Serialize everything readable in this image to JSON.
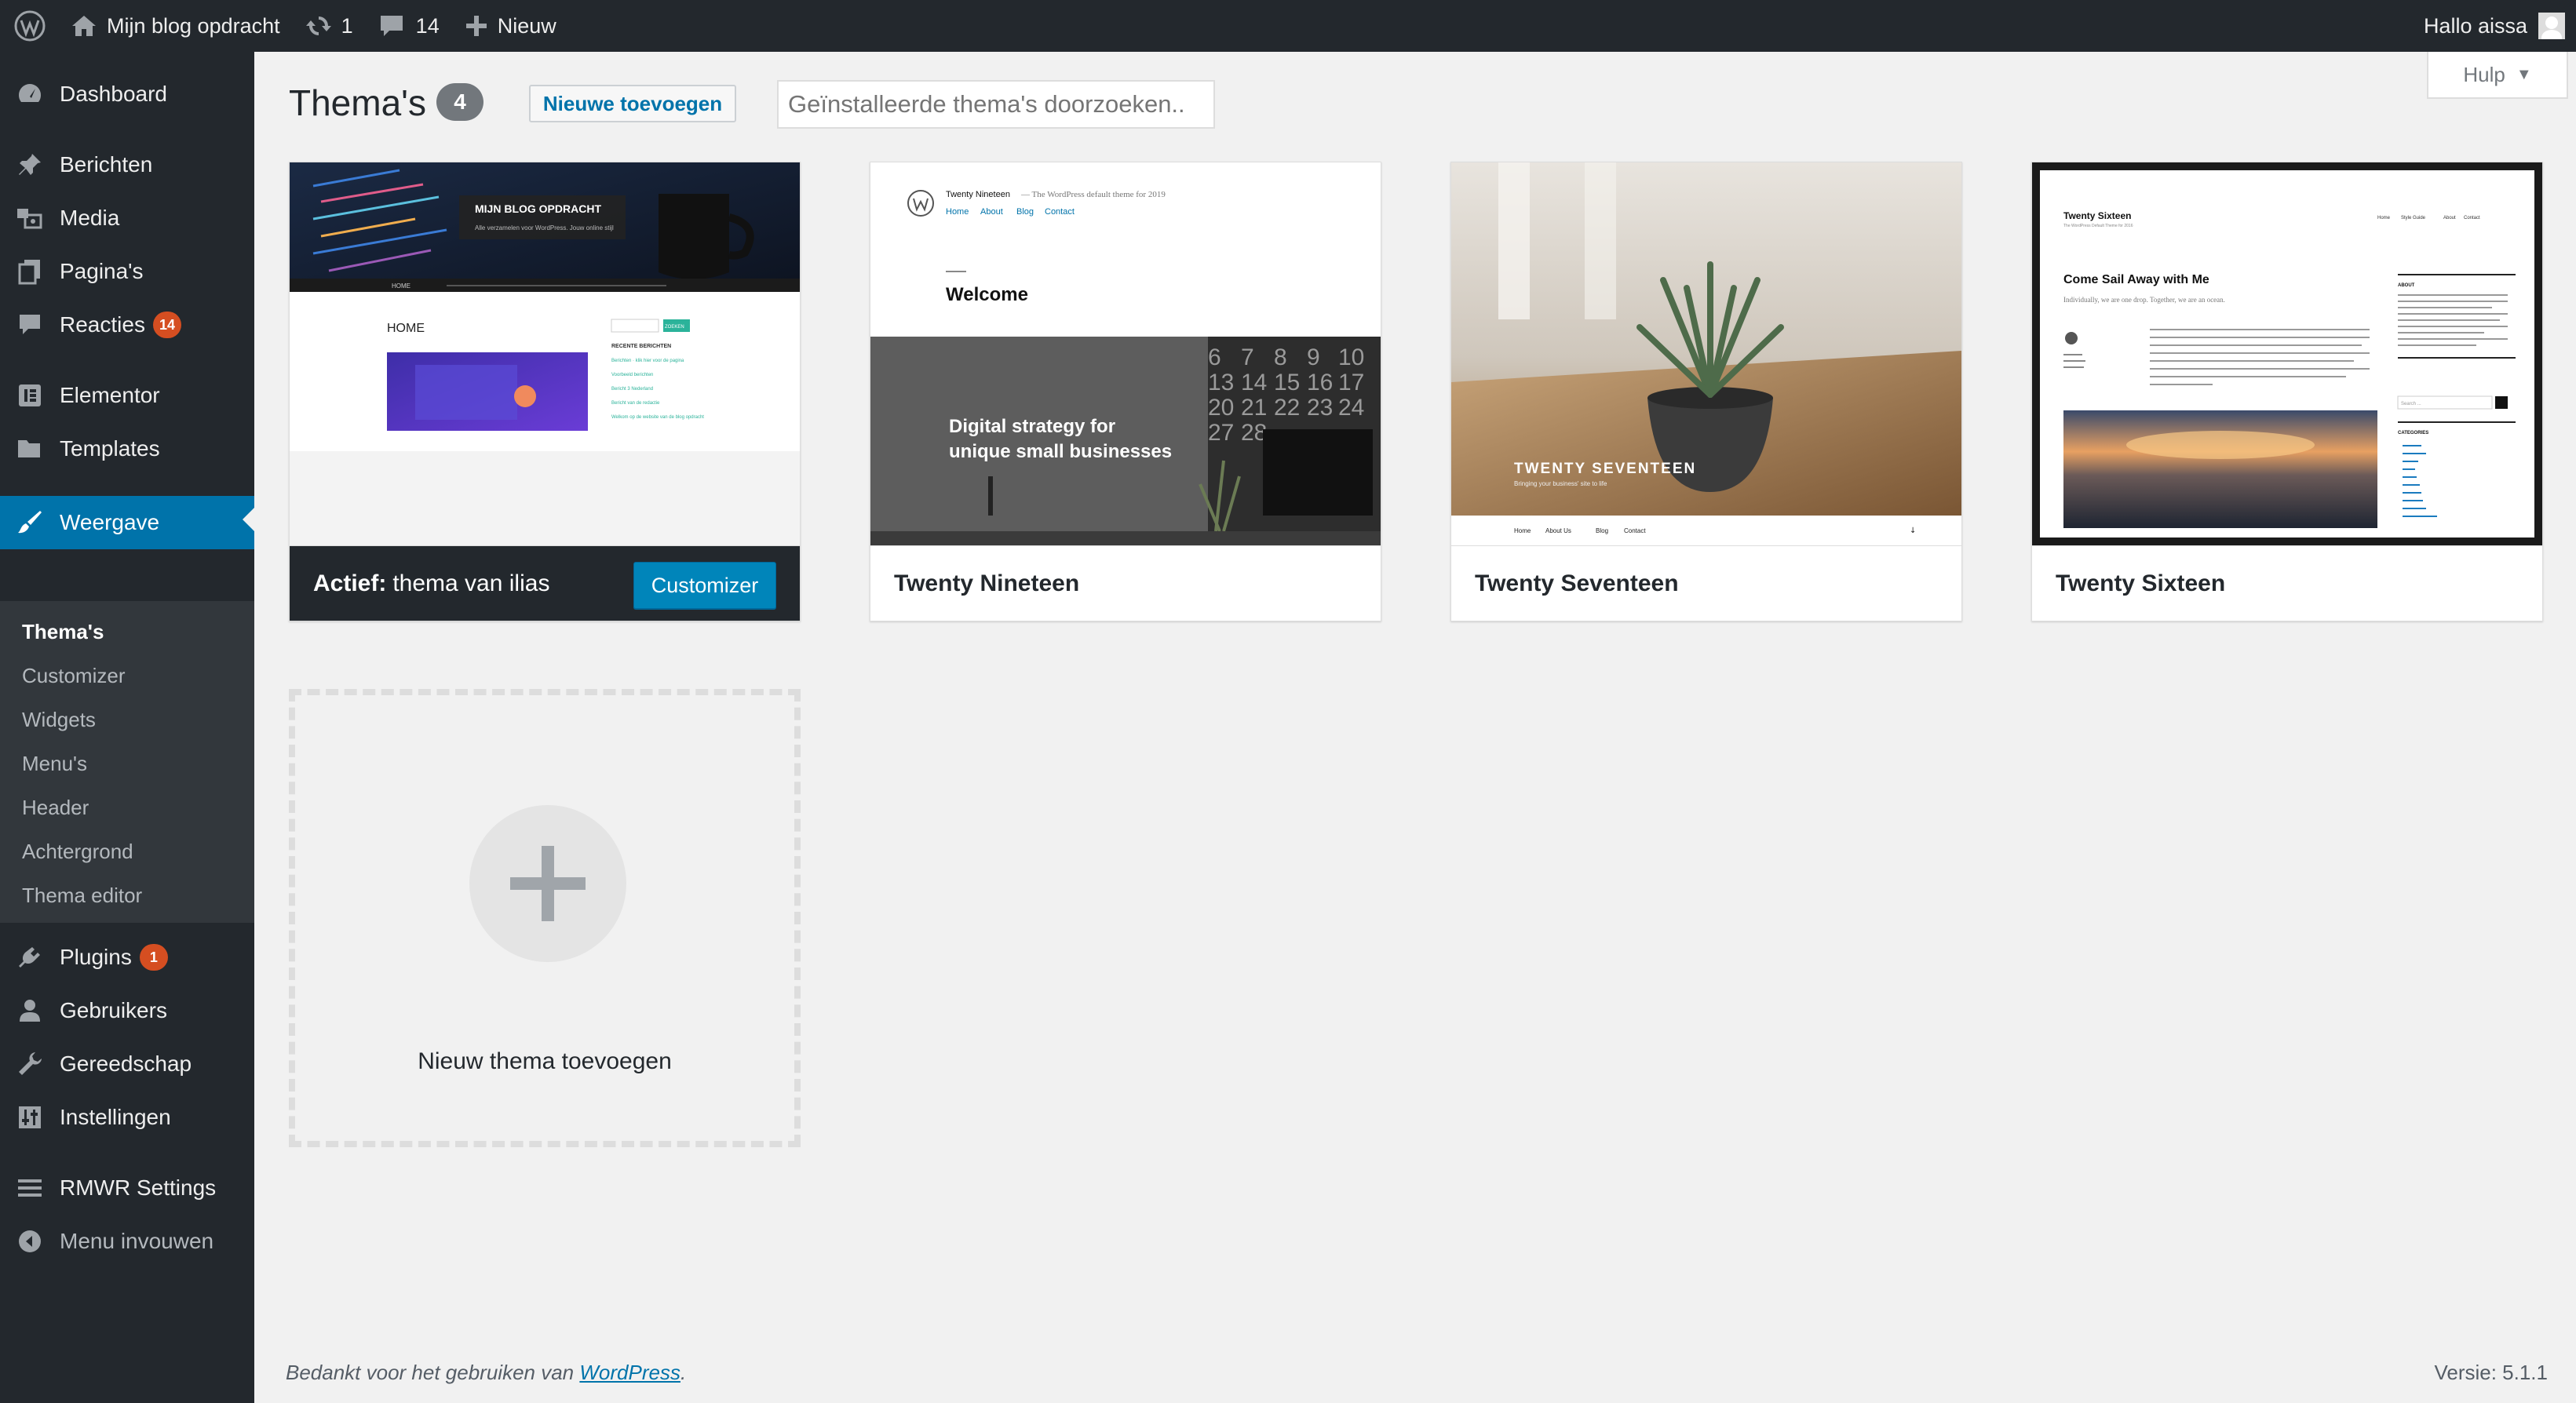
{
  "adminbar": {
    "site_name": "Mijn blog opdracht",
    "updates_count": "1",
    "comments_count": "14",
    "new_label": "Nieuw",
    "greeting": "Hallo aissa"
  },
  "sidebar": {
    "items": [
      {
        "label": "Dashboard",
        "icon": "dashboard-icon"
      },
      {
        "label": "Berichten",
        "icon": "pin-icon"
      },
      {
        "label": "Media",
        "icon": "media-icon"
      },
      {
        "label": "Pagina's",
        "icon": "page-icon"
      },
      {
        "label": "Reacties",
        "icon": "comment-icon",
        "badge": "14"
      },
      {
        "label": "Elementor",
        "icon": "elementor-icon"
      },
      {
        "label": "Templates",
        "icon": "folder-icon"
      },
      {
        "label": "Weergave",
        "icon": "brush-icon"
      },
      {
        "label": "Plugins",
        "icon": "plugin-icon",
        "badge": "1"
      },
      {
        "label": "Gebruikers",
        "icon": "user-icon"
      },
      {
        "label": "Gereedschap",
        "icon": "wrench-icon"
      },
      {
        "label": "Instellingen",
        "icon": "settings-icon"
      },
      {
        "label": "RMWR Settings",
        "icon": "list-icon"
      },
      {
        "label": "Menu invouwen",
        "icon": "collapse-icon"
      }
    ],
    "submenu": [
      "Thema's",
      "Customizer",
      "Widgets",
      "Menu's",
      "Header",
      "Achtergrond",
      "Thema editor"
    ]
  },
  "page": {
    "title": "Thema's",
    "count": "4",
    "add_new_label": "Nieuwe toevoegen",
    "search_placeholder": "Geïnstalleerde thema's doorzoeken...",
    "help_label": "Hulp"
  },
  "themes": [
    {
      "active_prefix": "Actief:",
      "name": "thema van ilias",
      "customize_label": "Customizer",
      "shot": {
        "header": "MIJN BLOG OPDRACHT",
        "sub": "Alle verzamelen voor WordPress. Jouw online stijl",
        "nav": "HOME",
        "home": "HOME",
        "search_btn": "ZOEKEN",
        "side_title": "RECENTE BERICHTEN",
        "links": [
          "Berichten · klik hier voor de pagina",
          "Voorbeeld berichten",
          "Bericht 3 Nederland",
          "Bericht van de redactie",
          "Welkom op de website van de blog opdracht"
        ]
      }
    },
    {
      "name": "Twenty Nineteen",
      "shot": {
        "site": "Twenty Nineteen",
        "tagline": "— The WordPress default theme for 2019",
        "nav": [
          "Home",
          "About",
          "Blog",
          "Contact"
        ],
        "welcome": "Welcome",
        "hero": "Digital strategy for unique small businesses",
        "calendar": [
          "6",
          "7",
          "8",
          "9",
          "10",
          "13",
          "14",
          "15",
          "16",
          "17",
          "20",
          "21",
          "22",
          "23",
          "24",
          "27",
          "28"
        ]
      }
    },
    {
      "name": "Twenty Seventeen",
      "shot": {
        "title": "TWENTY SEVENTEEN",
        "tagline": "Bringing your business' site to life",
        "nav": [
          "Home",
          "About Us",
          "Blog",
          "Contact"
        ]
      }
    },
    {
      "name": "Twenty Sixteen",
      "shot": {
        "site": "Twenty Sixteen",
        "tagline": "The WordPress Default Theme for 2016",
        "nav": [
          "Home",
          "Style Guide",
          "About",
          "Contact"
        ],
        "post_title": "Come Sail Away with Me",
        "post_sub": "Individually, we are one drop. Together, we are an ocean.",
        "about": "ABOUT",
        "categories": "CATEGORIES",
        "search": "Search ..."
      }
    }
  ],
  "add_theme_label": "Nieuw thema toevoegen",
  "footer": {
    "thanks": "Bedankt voor het gebruiken van",
    "link": "WordPress",
    "period": ".",
    "version": "Versie: 5.1.1"
  },
  "colors": {
    "adminbar": "#23282d",
    "accent": "#0073aa",
    "badge": "#d54e21",
    "submenu": "#32373c"
  }
}
